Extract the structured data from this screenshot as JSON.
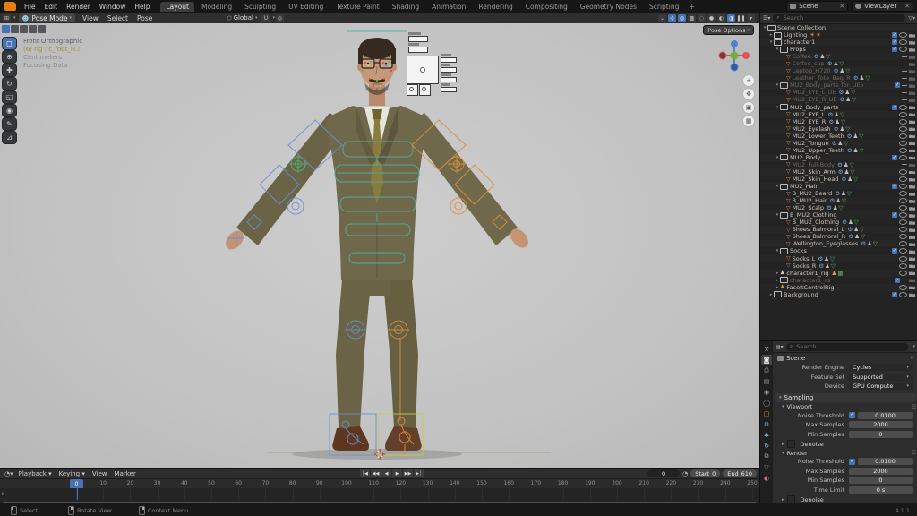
{
  "topbar": {
    "menus": [
      "File",
      "Edit",
      "Render",
      "Window",
      "Help"
    ],
    "tabs": [
      "Layout",
      "Modeling",
      "Sculpting",
      "UV Editing",
      "Texture Paint",
      "Shading",
      "Animation",
      "Rendering",
      "Compositing",
      "Geometry Nodes",
      "Scripting"
    ],
    "active_tab": "Layout",
    "add_tab_icon": "+",
    "scene": "Scene",
    "view_layer": "ViewLayer"
  },
  "viewport_header": {
    "mode": "Pose Mode",
    "menus": [
      "View",
      "Select",
      "Pose"
    ],
    "orientation": "Global",
    "right_icons": [
      "selectability-dropdown",
      "gizmos-toggle",
      "overlays-toggle",
      "xray-toggle",
      "shading-wireframe",
      "shading-solid",
      "shading-material",
      "shading-rendered",
      "pause-button",
      "render-preview-dropdown"
    ]
  },
  "viewport": {
    "overlay_lines": [
      "Front Orthographic",
      "(6) rig : c_foot_ik.l",
      "Centimeters",
      "Focusing Data"
    ],
    "pose_options_label": "Pose Options",
    "toolbar_tools": [
      "select-box",
      "cursor",
      "move",
      "rotate",
      "scale",
      "transform",
      "annotate",
      "measure"
    ],
    "view_buttons": [
      "zoom",
      "pan-hand",
      "camera-view",
      "toggle-ortho"
    ],
    "axis_colors": {
      "x": "#e0555c",
      "y": "#6fae3f",
      "z": "#4f83d2"
    }
  },
  "outliner": {
    "search_placeholder": "Search",
    "rows": [
      {
        "n": "Scene Collection",
        "l": 0,
        "t": "col",
        "exp": "v",
        "c": 0,
        "e": -1,
        "cam": 0
      },
      {
        "n": "Lighting",
        "l": 1,
        "t": "col",
        "exp": ">",
        "c": 1,
        "e": 1,
        "cam": 1,
        "extra": "lights"
      },
      {
        "n": "character1",
        "l": 1,
        "t": "col",
        "exp": "v",
        "c": 1,
        "e": 1,
        "cam": 1
      },
      {
        "n": "Props",
        "l": 2,
        "t": "col",
        "exp": "v",
        "c": 1,
        "e": 1,
        "cam": 1
      },
      {
        "n": "Coffee",
        "l": 3,
        "t": "mesh",
        "d": 1,
        "e": 0,
        "cam": 1,
        "m": 1
      },
      {
        "n": "Coffee_cup",
        "l": 3,
        "t": "mesh",
        "d": 1,
        "e": 0,
        "cam": 1,
        "m": 1
      },
      {
        "n": "Laptop_H720",
        "l": 3,
        "t": "mesh",
        "d": 1,
        "e": 0,
        "cam": 1,
        "m": 1
      },
      {
        "n": "Leather_Tote_Bag_R",
        "l": 3,
        "t": "mesh",
        "d": 1,
        "e": 0,
        "cam": 1,
        "m": 1
      },
      {
        "n": "MU2_Body_parts_for_UE5",
        "l": 2,
        "t": "col",
        "exp": "v",
        "d": 1,
        "c": 1,
        "e": 0,
        "cam": 1
      },
      {
        "n": "MU2_EYE_L_UE",
        "l": 3,
        "t": "mesh",
        "d": 1,
        "e": 0,
        "cam": 1,
        "m": 1
      },
      {
        "n": "MU2_EYE_R_UE",
        "l": 3,
        "t": "mesh",
        "d": 1,
        "e": 0,
        "cam": 1,
        "m": 1
      },
      {
        "n": "MU2_Body_parts",
        "l": 2,
        "t": "col",
        "exp": "v",
        "c": 1,
        "e": 1,
        "cam": 1
      },
      {
        "n": "MU2_EYE_L",
        "l": 3,
        "t": "mesh",
        "e": 1,
        "cam": 1,
        "m": 1
      },
      {
        "n": "MU2_EYE_R",
        "l": 3,
        "t": "mesh",
        "e": 1,
        "cam": 1,
        "m": 1
      },
      {
        "n": "MU2_Eyelash",
        "l": 3,
        "t": "mesh",
        "e": 1,
        "cam": 1,
        "m": 1
      },
      {
        "n": "MU2_Lower_Teeth",
        "l": 3,
        "t": "mesh",
        "e": 1,
        "cam": 1,
        "m": 1
      },
      {
        "n": "MU2_Tongue",
        "l": 3,
        "t": "mesh",
        "e": 1,
        "cam": 1,
        "m": 1
      },
      {
        "n": "MU2_Upper_Teeth",
        "l": 3,
        "t": "mesh",
        "e": 1,
        "cam": 1,
        "m": 1
      },
      {
        "n": "MU2_Body",
        "l": 2,
        "t": "col",
        "exp": "v",
        "c": 1,
        "e": 1,
        "cam": 1
      },
      {
        "n": "MU2_Full-Body",
        "l": 3,
        "t": "mesh",
        "d": 1,
        "e": 0,
        "cam": 1,
        "m": 1
      },
      {
        "n": "MU2_Skin_Arm",
        "l": 3,
        "t": "mesh",
        "e": 1,
        "cam": 1,
        "m": 1
      },
      {
        "n": "MU2_Skin_Head",
        "l": 3,
        "t": "mesh",
        "e": 1,
        "cam": 1,
        "m": 1
      },
      {
        "n": "MU2_Hair",
        "l": 2,
        "t": "col",
        "exp": "v",
        "c": 1,
        "e": 1,
        "cam": 1
      },
      {
        "n": "B_MU2_Beard",
        "l": 3,
        "t": "mesh",
        "e": 1,
        "cam": 1,
        "m": 1
      },
      {
        "n": "B_MU2_Hair",
        "l": 3,
        "t": "mesh",
        "e": 1,
        "cam": 1,
        "m": 1
      },
      {
        "n": "MU2_Scalp",
        "l": 3,
        "t": "mesh",
        "e": 1,
        "cam": 1,
        "m": 1
      },
      {
        "n": "B_MU2_Clothing",
        "l": 2,
        "t": "col",
        "exp": "v",
        "c": 1,
        "e": 1,
        "cam": 1
      },
      {
        "n": "B_MU2_Clothing",
        "l": 3,
        "t": "mesh",
        "e": 1,
        "cam": 1,
        "m": 1
      },
      {
        "n": "Shoes_Balmoral_L",
        "l": 3,
        "t": "mesh",
        "e": 1,
        "cam": 1,
        "m": 1
      },
      {
        "n": "Shoes_Balmoral_R",
        "l": 3,
        "t": "mesh",
        "e": 1,
        "cam": 1,
        "m": 1
      },
      {
        "n": "Wellington_Eyeglasses",
        "l": 3,
        "t": "mesh",
        "e": 1,
        "cam": 1,
        "m": 1
      },
      {
        "n": "Socks",
        "l": 2,
        "t": "col",
        "exp": "v",
        "c": 1,
        "e": 1,
        "cam": 1
      },
      {
        "n": "Socks_L",
        "l": 3,
        "t": "mesh",
        "e": 1,
        "cam": 1,
        "m": 1
      },
      {
        "n": "Socks_R",
        "l": 3,
        "t": "mesh",
        "e": 1,
        "cam": 1,
        "m": 1
      },
      {
        "n": "character1_rig",
        "l": 2,
        "t": "arm",
        "exp": ">",
        "e": 1,
        "cam": 1,
        "extra": "rig"
      },
      {
        "n": "character1_cs",
        "l": 2,
        "t": "col",
        "exp": ">",
        "d": 1,
        "c": 1,
        "e": 0,
        "cam": 1
      },
      {
        "n": "FaceItControlRig",
        "l": 2,
        "t": "armsel",
        "exp": ">",
        "e": 1,
        "cam": 1
      },
      {
        "n": "Background",
        "l": 1,
        "t": "col",
        "exp": ">",
        "c": 1,
        "e": 1,
        "cam": 1
      }
    ]
  },
  "properties": {
    "search_placeholder": "Search",
    "breadcrumb": "Scene",
    "tabs": [
      "tool",
      "render",
      "output",
      "view-layer",
      "scene",
      "world",
      "object",
      "modifiers",
      "particles",
      "physics",
      "constraints",
      "object-data",
      "material"
    ],
    "active_tab": "render",
    "engine_rows": [
      {
        "label": "Render Engine",
        "value": "Cycles"
      },
      {
        "label": "Feature Set",
        "value": "Supported"
      },
      {
        "label": "Device",
        "value": "GPU Compute"
      }
    ],
    "sampling_title": "Sampling",
    "viewport_title": "Viewport",
    "viewport_fields": [
      {
        "label": "Noise Threshold",
        "value": "0.0100",
        "cb": true
      },
      {
        "label": "Max Samples",
        "value": "2000"
      },
      {
        "label": "Min Samples",
        "value": "0"
      }
    ],
    "render_title": "Render",
    "render_fields": [
      {
        "label": "Noise Threshold",
        "value": "0.0100",
        "cb": true
      },
      {
        "label": "Max Samples",
        "value": "2000"
      },
      {
        "label": "Min Samples",
        "value": "0"
      },
      {
        "label": "Time Limit",
        "value": "0 s"
      }
    ],
    "denoise_label": "Denoise"
  },
  "timeline": {
    "menus": [
      "Playback",
      "Keying",
      "View",
      "Marker"
    ],
    "transport": [
      "jump-to-start",
      "prev-keyframe",
      "play-reverse",
      "play",
      "next-keyframe",
      "jump-to-end"
    ],
    "current_frame": "0",
    "start_label": "Start",
    "start_value": "0",
    "end_label": "End",
    "end_value": "610",
    "ticks": [
      0,
      10,
      20,
      30,
      40,
      50,
      60,
      70,
      80,
      90,
      100,
      110,
      120,
      130,
      140,
      150,
      160,
      170,
      180,
      190,
      200,
      210,
      220,
      230,
      240,
      250
    ]
  },
  "status_bar": {
    "hints": [
      "Select",
      "Rotate View",
      "Context Menu"
    ],
    "version": "4.1.1"
  }
}
